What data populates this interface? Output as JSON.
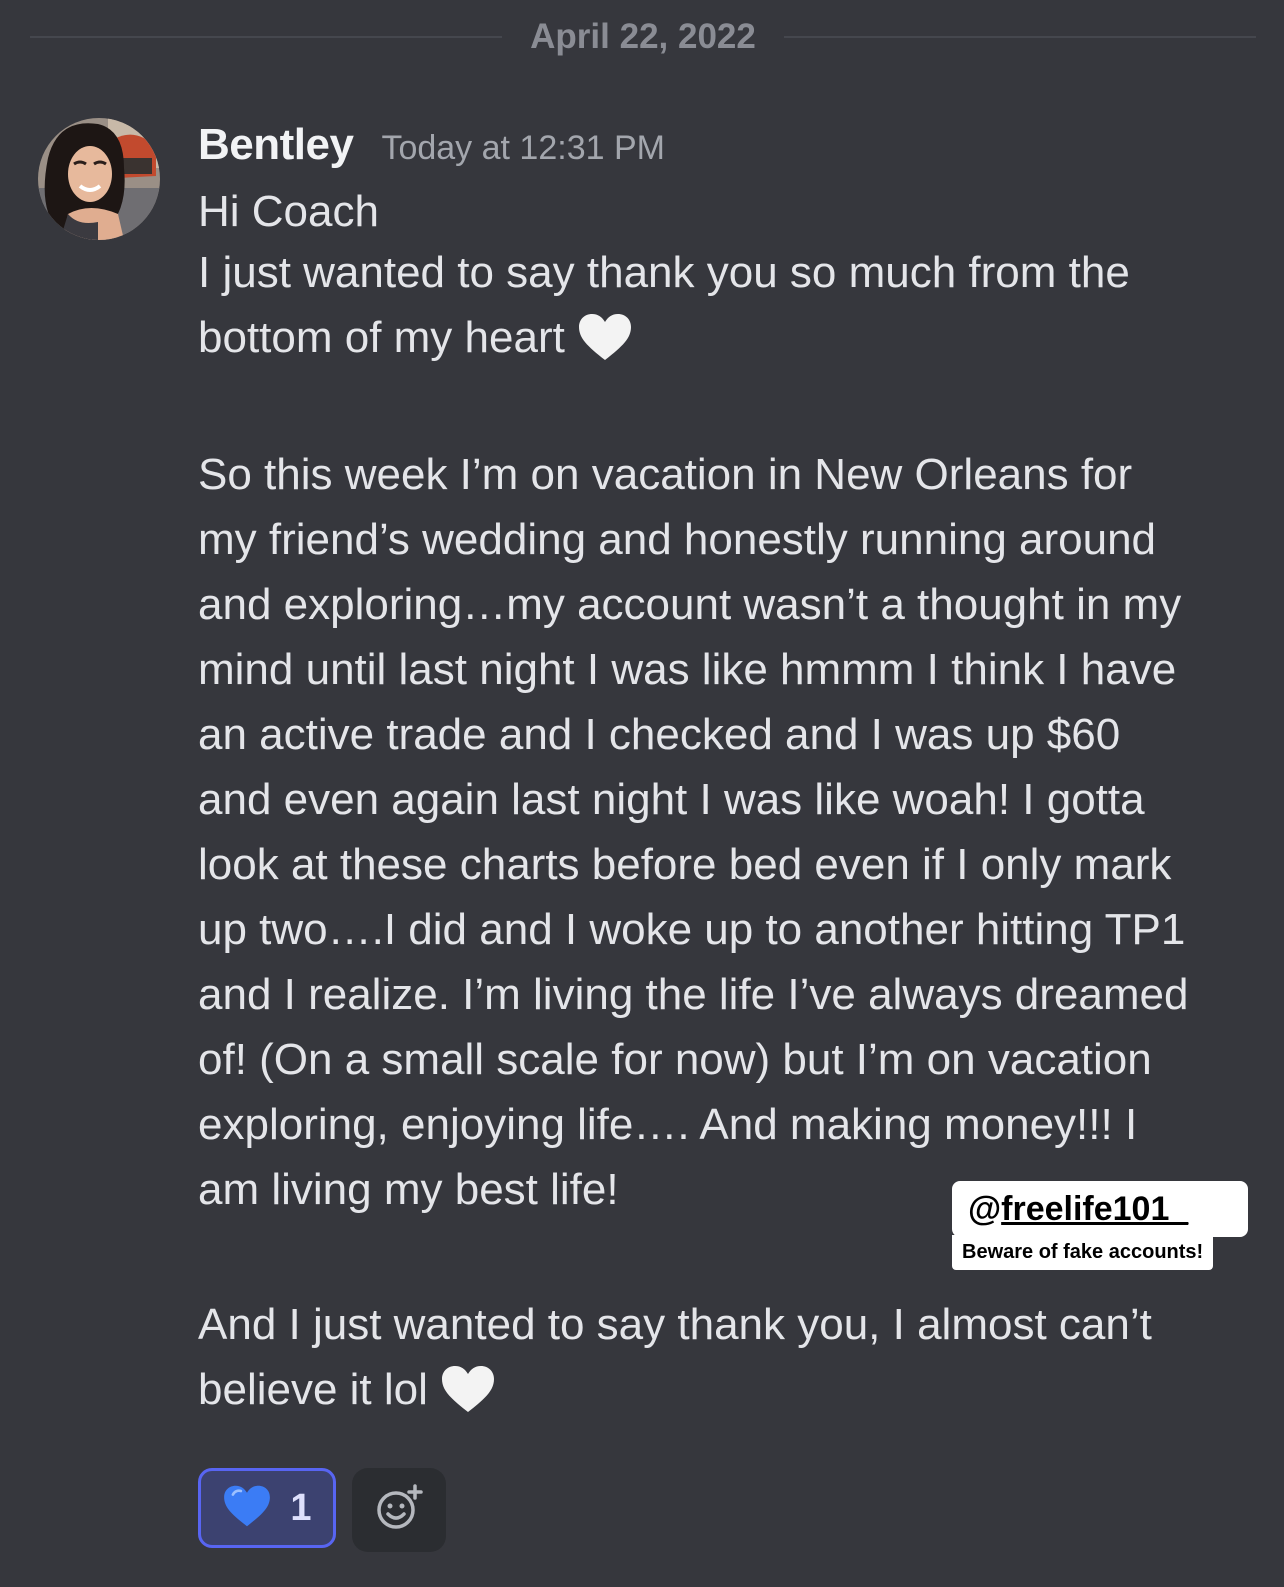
{
  "date_divider": "April 22, 2022",
  "message": {
    "username": "Bentley",
    "timestamp": "Today at 12:31 PM",
    "greeting": "Hi Coach",
    "para1": "I just wanted to say thank you so much from the\nbottom of my heart",
    "para2": "So this week I’m on vacation in New Orleans for\nmy friend’s wedding and honestly running around\nand exploring…my account wasn’t a thought in my\nmind until last night I was like hmmm I think I have\nan active trade and I checked and I was up $60\nand even again last night I was like woah! I gotta\nlook at these charts before bed even if I only mark\nup two….I did and I woke up to another hitting TP1\nand I realize. I’m living the life I’ve always dreamed\nof! (On a small scale for now) but I’m on vacation\nexploring, enjoying life…. And making money!!!  I\nam living my best life!",
    "para3": "And I just wanted to say thank you, I almost can’t\nbelieve it lol"
  },
  "watermark": {
    "handle_prefix": "@",
    "handle": "freelife101_",
    "warning": "Beware of fake accounts!"
  },
  "reactions": [
    {
      "emoji": "blue-heart",
      "count": "1",
      "color": "#3b7cf5"
    }
  ],
  "colors": {
    "background": "#36373d",
    "accent": "#5865f2"
  }
}
